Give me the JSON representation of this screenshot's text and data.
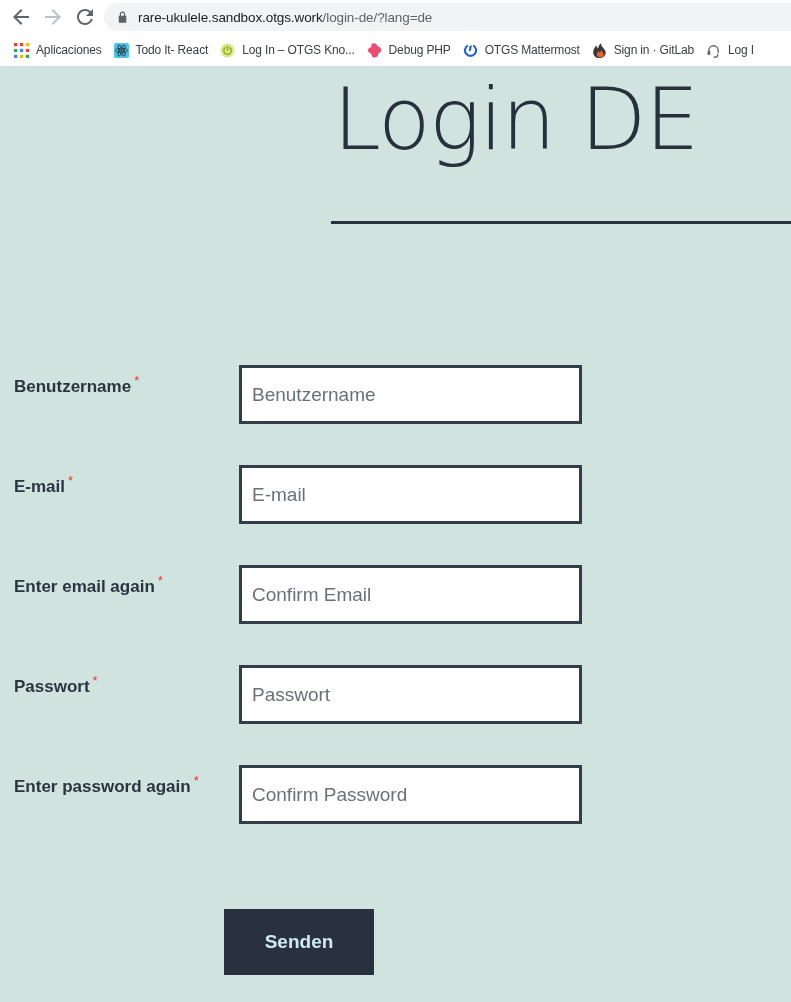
{
  "browser": {
    "nav_buttons": [
      {
        "kind": "back",
        "disabled": false
      },
      {
        "kind": "forward",
        "disabled": true
      },
      {
        "kind": "reload",
        "disabled": false
      }
    ],
    "address": {
      "host": "rare-ukulele.sandbox.otgs.work",
      "path": "/login-de/?lang=de"
    }
  },
  "bookmarks": [
    {
      "kind": "apps",
      "label": "Aplicaciones"
    },
    {
      "kind": "atom",
      "label": "Todo It- React"
    },
    {
      "kind": "power",
      "label": "Log In – OTGS Kno..."
    },
    {
      "kind": "blob",
      "label": "Debug PHP"
    },
    {
      "kind": "ring",
      "label": "OTGS Mattermost"
    },
    {
      "kind": "flame",
      "label": "Sign in · GitLab"
    },
    {
      "kind": "headset",
      "label": "Log I"
    }
  ],
  "page": {
    "title": "Login DE",
    "fields": [
      {
        "label": "Benutzername",
        "required_mark": "*",
        "placeholder": "Benutzername"
      },
      {
        "label": "E-mail",
        "required_mark": "*",
        "placeholder": "E-mail"
      },
      {
        "label": "Enter email again",
        "required_mark": "*",
        "placeholder": "Confirm Email"
      },
      {
        "label": "Passwort",
        "required_mark": "*",
        "placeholder": "Passwort"
      },
      {
        "label": "Enter password again",
        "required_mark": "*",
        "placeholder": "Confirm Password"
      }
    ],
    "submit_button": "Senden"
  }
}
